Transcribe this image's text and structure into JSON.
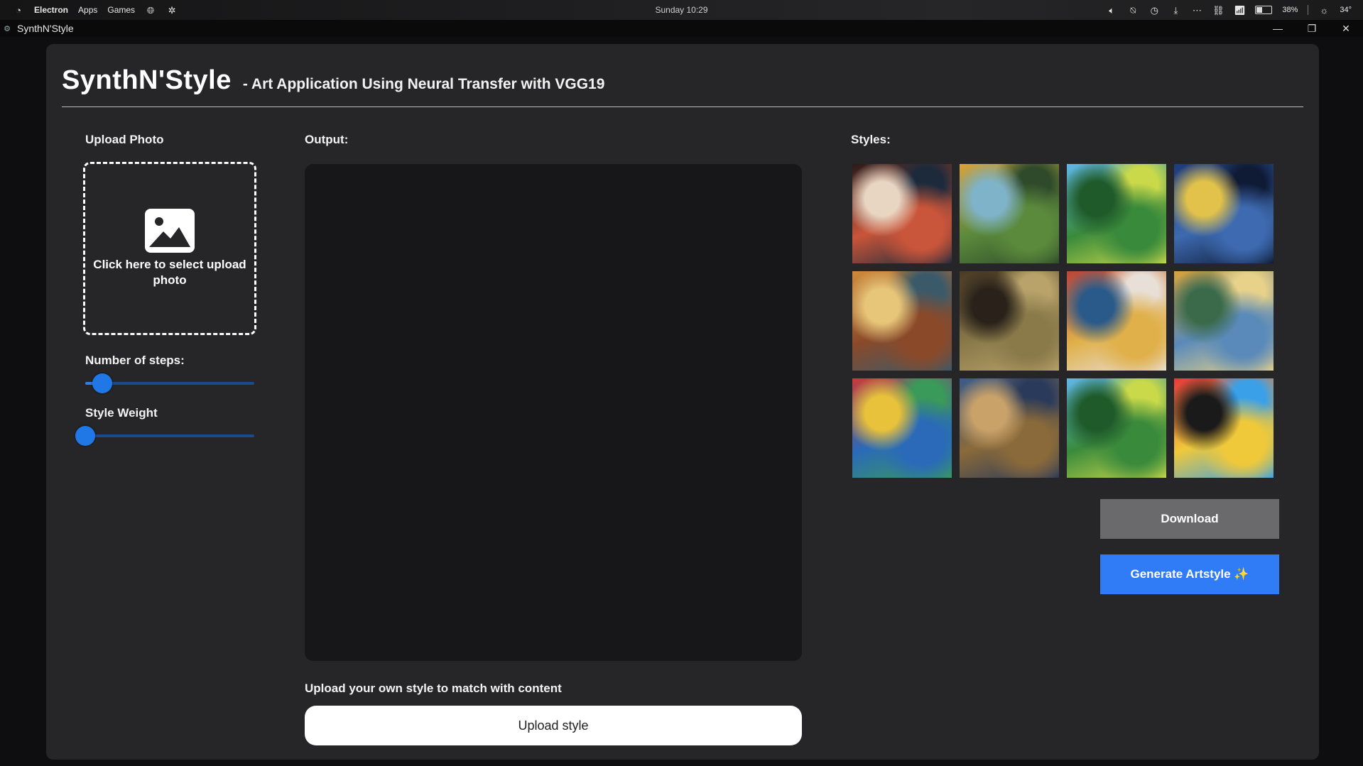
{
  "os_bar": {
    "app_name": "Electron",
    "menu_apps": "Apps",
    "menu_games": "Games",
    "clock": "Sunday 10:29",
    "battery": "38%",
    "weather": "34°"
  },
  "window": {
    "title": "SynthN'Style",
    "minimize": "—",
    "maximize": "❐",
    "close": "✕"
  },
  "header": {
    "brand": "SynthN'Style",
    "subtitle": "- Art Application Using Neural Transfer with VGG19"
  },
  "left_panel": {
    "upload_label": "Upload Photo",
    "upload_prompt": "Click here to select upload photo",
    "steps_label": "Number of steps:",
    "steps_value": 0.1,
    "style_weight_label": "Style Weight",
    "style_weight_value": 0.0
  },
  "center_panel": {
    "output_label": "Output:",
    "upload_style_prompt": "Upload your own style to match with content",
    "upload_style_button": "Upload style"
  },
  "right_panel": {
    "styles_label": "Styles:",
    "styles": [
      {
        "name": "anime-floral-girl",
        "colors": [
          "#2b1a1a",
          "#c9553a",
          "#e9d6c2",
          "#1d2a3b"
        ]
      },
      {
        "name": "fantasy-castle-landscape",
        "colors": [
          "#d9a23a",
          "#5b8a3c",
          "#7fb3c9",
          "#2f4a2a"
        ]
      },
      {
        "name": "green-hills-landscape",
        "colors": [
          "#5fb6e8",
          "#3a8a3c",
          "#1f5a2a",
          "#c9d94a"
        ]
      },
      {
        "name": "starry-night",
        "colors": [
          "#1d3a7a",
          "#3d6ab0",
          "#e2c24a",
          "#0f1a35"
        ]
      },
      {
        "name": "city-street-painting",
        "colors": [
          "#d08a3a",
          "#8a4a2a",
          "#e7c67a",
          "#3a5a6a"
        ]
      },
      {
        "name": "mona-lisa",
        "colors": [
          "#4a3a24",
          "#8a7a4a",
          "#2a221a",
          "#b9a36a"
        ]
      },
      {
        "name": "cubist-portrait",
        "colors": [
          "#b9443a",
          "#e0b04a",
          "#2a5a8a",
          "#e8e0d8"
        ]
      },
      {
        "name": "van-gogh-bedroom",
        "colors": [
          "#d9a23a",
          "#5a8ab9",
          "#3a6a4a",
          "#e8d28a"
        ]
      },
      {
        "name": "abstract-face",
        "colors": [
          "#c93a3a",
          "#2a6ab9",
          "#e8c23a",
          "#3a9a5a"
        ]
      },
      {
        "name": "van-gogh-self-portrait",
        "colors": [
          "#3a5a8a",
          "#8a6a3a",
          "#c9a26a",
          "#2a3a5a"
        ]
      },
      {
        "name": "green-hills-landscape-2",
        "colors": [
          "#5fb6e8",
          "#3a8a3c",
          "#1f5a2a",
          "#c9d94a"
        ]
      },
      {
        "name": "pop-art-woman",
        "colors": [
          "#e83a3a",
          "#f0c93a",
          "#1a1a1a",
          "#3aa0e8"
        ]
      }
    ],
    "download_button": "Download",
    "generate_button": "Generate Artstyle ✨"
  }
}
